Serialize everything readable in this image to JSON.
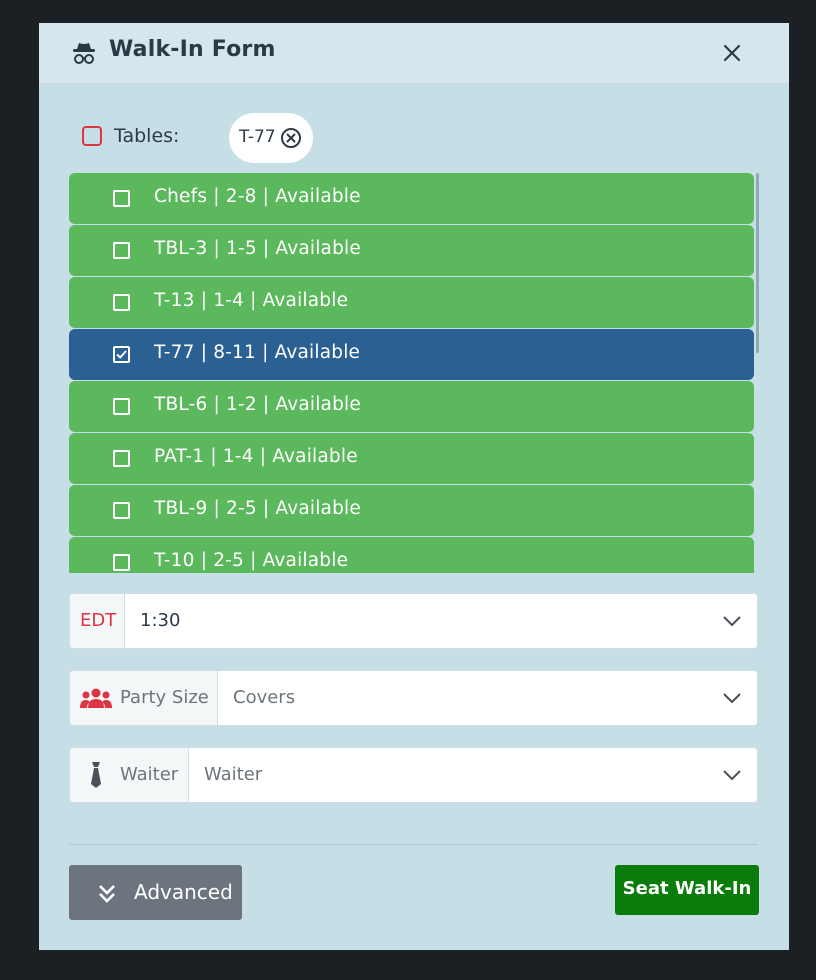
{
  "header": {
    "title": "Walk-In Form",
    "icon": "user-secret-icon",
    "close_icon": "close-icon"
  },
  "tables": {
    "label": "Tables:",
    "selected_chip": "T-77"
  },
  "table_list": [
    {
      "label": "Chefs | 2-8 | Available",
      "checked": false
    },
    {
      "label": "TBL-3 | 1-5 | Available",
      "checked": false
    },
    {
      "label": "T-13 | 1-4 | Available",
      "checked": false
    },
    {
      "label": "T-77 | 8-11 | Available",
      "checked": true
    },
    {
      "label": "TBL-6 | 1-2 | Available",
      "checked": false
    },
    {
      "label": "PAT-1 | 1-4 | Available",
      "checked": false
    },
    {
      "label": "TBL-9 | 2-5 | Available",
      "checked": false
    },
    {
      "label": "T-10 | 2-5 | Available",
      "checked": false
    }
  ],
  "edt": {
    "prefix": "EDT",
    "value": "1:30"
  },
  "party_size": {
    "prefix": "Party Size",
    "placeholder": "Covers",
    "icon": "users-icon"
  },
  "waiter": {
    "prefix": "Waiter",
    "placeholder": "Waiter",
    "icon": "tie-icon"
  },
  "footer": {
    "advanced_label": "Advanced",
    "seat_label": "Seat Walk-In"
  },
  "colors": {
    "available": "#5cb85c",
    "selected": "#2b6093",
    "primary_action": "#0a7c0a",
    "danger": "#dc3545"
  }
}
